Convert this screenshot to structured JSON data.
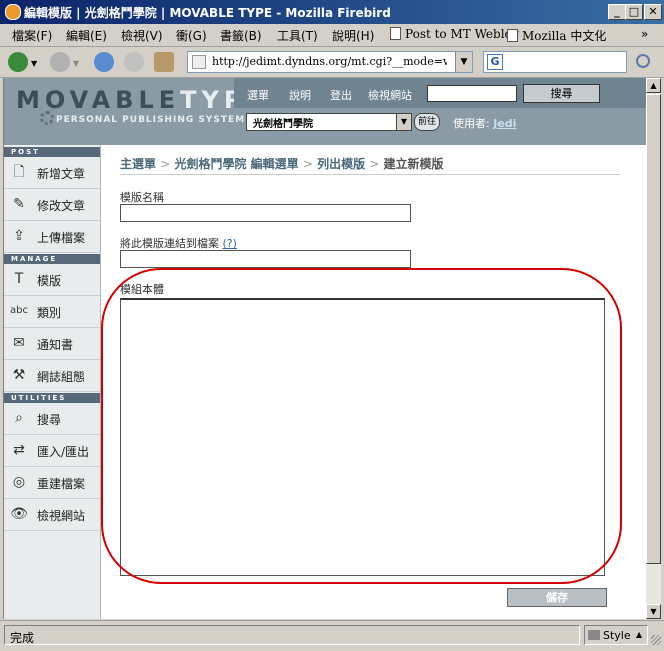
{
  "window": {
    "title": "編輯模版 | 光劍格鬥學院 | MOVABLE TYPE - Mozilla Firebird",
    "min": "_",
    "max": "□",
    "close": "✕"
  },
  "menubar": {
    "items": [
      "檔案(F)",
      "編輯(E)",
      "檢視(V)",
      "衝(G)",
      "書籤(B)",
      "工具(T)",
      "說明(H)"
    ],
    "bookmarks": [
      "Post to MT Weblog",
      "Mozilla 中文化"
    ],
    "overflow": "»"
  },
  "navbar": {
    "url": "http://jedimt.dyndns.org/mt.cgi?__mode=view&_typ",
    "search_engine": "G"
  },
  "mt": {
    "logo": {
      "movable": "MOVABLE",
      "type": "TYPE",
      "tagline": "PERSONAL PUBLISHING SYSTEM"
    },
    "topnav": [
      "選單",
      "說明",
      "登出",
      "檢視網站"
    ],
    "search_button": "搜尋",
    "blog_select": "光劍格鬥學院",
    "go_button": "前往",
    "user_label": "使用者:",
    "user_name": "Jedi"
  },
  "sidebar": {
    "sections": {
      "post": "POST",
      "manage": "MANAGE",
      "utilities": "UTILITIES"
    },
    "post_items": [
      {
        "label": "新增文章",
        "icon": "new-entry-icon"
      },
      {
        "label": "修改文章",
        "icon": "edit-entries-icon"
      },
      {
        "label": "上傳檔案",
        "icon": "upload-icon"
      }
    ],
    "manage_items": [
      {
        "label": "模版",
        "icon": "templates-icon"
      },
      {
        "label": "類別",
        "icon": "categories-icon"
      },
      {
        "label": "通知書",
        "icon": "notifications-icon"
      },
      {
        "label": "網誌組態",
        "icon": "config-icon"
      }
    ],
    "utility_items": [
      {
        "label": "搜尋",
        "icon": "search-icon"
      },
      {
        "label": "匯入/匯出",
        "icon": "import-export-icon"
      },
      {
        "label": "重建檔案",
        "icon": "rebuild-icon"
      },
      {
        "label": "檢視網站",
        "icon": "view-site-icon"
      }
    ]
  },
  "breadcrumb": [
    "主選單",
    "光劍格鬥學院 編輯選單",
    "列出模版",
    "建立新模版"
  ],
  "breadcrumb_sep": ">",
  "form": {
    "name_label": "模版名稱",
    "name_value": "",
    "link_label": "將此模版連結到檔案",
    "link_help": "(?)",
    "link_value": "",
    "body_label": "模組本體",
    "body_value": "",
    "save_button": "儲存"
  },
  "status": {
    "text": "完成",
    "style": "Style"
  },
  "colors": {
    "highlight_circle": "#d40000",
    "mt_header": "#8a9ba5",
    "sidebar_section": "#56687a"
  }
}
